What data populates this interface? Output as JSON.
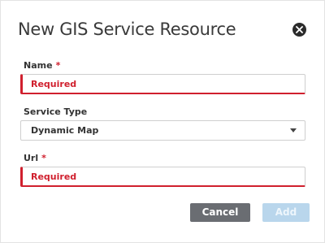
{
  "dialog": {
    "title": "New GIS Service Resource",
    "close_icon": "close-circle-icon"
  },
  "fields": {
    "name": {
      "label": "Name",
      "required_marker": "*",
      "placeholder": "Required",
      "value": ""
    },
    "service_type": {
      "label": "Service Type",
      "selected": "Dynamic Map"
    },
    "url": {
      "label": "Url",
      "required_marker": "*",
      "placeholder": "Required",
      "value": ""
    }
  },
  "buttons": {
    "cancel_label": "Cancel",
    "add_label": "Add"
  },
  "colors": {
    "error": "#d0202e",
    "cancel_bg": "#6a6d72",
    "add_bg_disabled": "#b9d6ec"
  }
}
